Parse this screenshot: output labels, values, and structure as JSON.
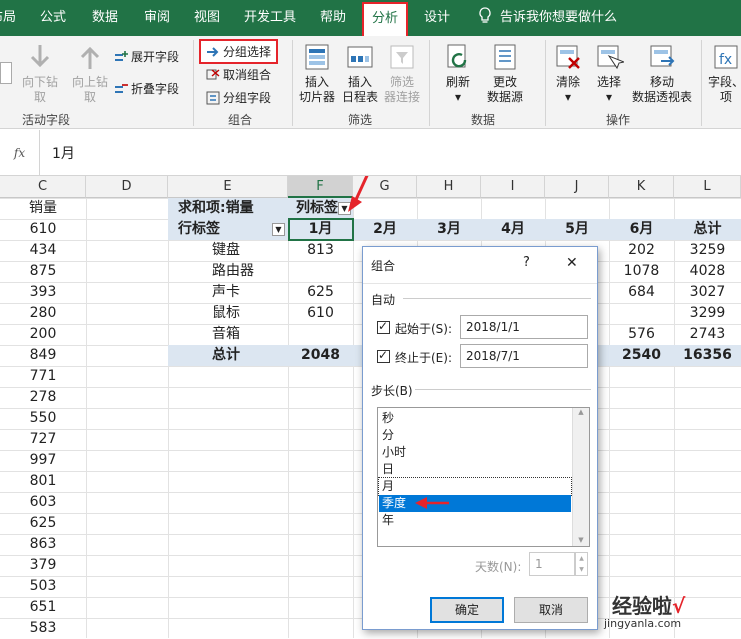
{
  "tabs": [
    "布局",
    "公式",
    "数据",
    "审阅",
    "视图",
    "开发工具",
    "帮助",
    "分析",
    "设计"
  ],
  "active_tab": "分析",
  "tell_me": "告诉我你想要做什么",
  "ribbon": {
    "active_field": {
      "drill_down": [
        "向下钻",
        "取"
      ],
      "drill_up": [
        "向上钻",
        "取"
      ],
      "expand": "展开字段",
      "collapse": "折叠字段",
      "label": "活动字段"
    },
    "group": {
      "group_selection": "分组选择",
      "ungroup": "取消组合",
      "group_field": "分组字段",
      "label": "组合"
    },
    "filter": {
      "insert_slicer": [
        "插入",
        "切片器"
      ],
      "insert_timeline": [
        "插入",
        "日程表"
      ],
      "filter_connections": [
        "筛选",
        "器连接"
      ],
      "label": "筛选"
    },
    "data": {
      "refresh": "刷新",
      "change_source": [
        "更改",
        "数据源"
      ],
      "label": "数据"
    },
    "actions": {
      "clear": "清除",
      "select": "选择",
      "move": [
        "移动",
        "数据透视表"
      ],
      "label": "操作"
    },
    "show": {
      "fields": [
        "字段、",
        "项"
      ]
    }
  },
  "formula_bar": {
    "fx": "fx",
    "value": "1月"
  },
  "columns": [
    "C",
    "D",
    "E",
    "F",
    "G",
    "H",
    "I",
    "J",
    "K",
    "L"
  ],
  "col_c_header": "销量",
  "col_c_values": [
    "610",
    "434",
    "875",
    "393",
    "280",
    "200",
    "849",
    "771",
    "278",
    "550",
    "727",
    "997",
    "801",
    "603",
    "625",
    "863",
    "379",
    "503",
    "651",
    "583"
  ],
  "pivot": {
    "sum_label": "求和项:销量",
    "col_label": "列标签",
    "row_label": "行标签",
    "months": [
      "1月",
      "2月",
      "3月",
      "4月",
      "5月",
      "6月"
    ],
    "total_col": "总计",
    "rows": [
      {
        "name": "键盘",
        "jan": "813",
        "jun": "202",
        "total": "3259"
      },
      {
        "name": "路由器",
        "jan": "",
        "jun": "1078",
        "total": "4028"
      },
      {
        "name": "声卡",
        "jan": "625",
        "jun": "684",
        "total": "3027"
      },
      {
        "name": "鼠标",
        "jan": "610",
        "jun": "",
        "total": "3299"
      },
      {
        "name": "音箱",
        "jan": "",
        "jun": "576",
        "total": "2743"
      }
    ],
    "total_row": {
      "name": "总计",
      "jan": "2048",
      "jun": "2540",
      "total": "16356"
    }
  },
  "dialog": {
    "title": "组合",
    "help": "?",
    "close": "✕",
    "auto_label": "自动",
    "start_label": "起始于(S):",
    "start_value": "2018/1/1",
    "end_label": "终止于(E):",
    "end_value": "2018/7/1",
    "step_label": "步长(B)",
    "step_items": [
      "秒",
      "分",
      "小时",
      "日",
      "月",
      "季度",
      "年"
    ],
    "selected_item": "季度",
    "days_label": "天数(N):",
    "days_value": "1",
    "ok": "确定",
    "cancel": "取消"
  },
  "watermark": {
    "text": "经验啦",
    "url": "jingyanla.com",
    "check": "√"
  },
  "colors": {
    "excel_green": "#217346",
    "highlight_red": "#e5242b",
    "selection_blue": "#0078d7"
  }
}
